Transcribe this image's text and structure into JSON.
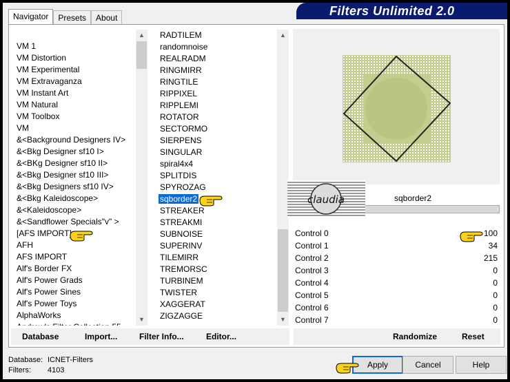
{
  "window": {
    "title": "Filters Unlimited 2.0"
  },
  "tabs": [
    {
      "label": "Navigator",
      "active": true
    },
    {
      "label": "Presets",
      "active": false
    },
    {
      "label": "About",
      "active": false
    }
  ],
  "categories": [
    "VM 1",
    "VM Distortion",
    "VM Experimental",
    "VM Extravaganza",
    "VM Instant Art",
    "VM Natural",
    "VM Toolbox",
    "VM",
    "&<Background Designers IV>",
    "&<Bkg Designer sf10 I>",
    "&<BKg Designer sf10 II>",
    "&<Bkg Designer sf10 III>",
    "&<Bkg Designers sf10 IV>",
    "&<Bkg Kaleidoscope>",
    "&<Kaleidoscope>",
    "&<Sandflower Specials\"v\" >",
    "[AFS IMPORT]",
    "AFH",
    "AFS IMPORT",
    "Alf's Border FX",
    "Alf's Power Grads",
    "Alf's Power Sines",
    "Alf's Power Toys",
    "AlphaWorks",
    "Andrew's Filter Collection 55"
  ],
  "filters": [
    "RADTILEM",
    "randomnoise",
    "REALRADM",
    "RINGMIRR",
    "RINGTILE",
    "RIPPIXEL",
    "RIPPLEMI",
    "ROTATOR",
    "SECTORMO",
    "SIERPENS",
    "SINGULAR",
    "spiral4x4",
    "SPLITDIS",
    "SPYROZAG",
    "sqborder2",
    "STREAKER",
    "STREAKMI",
    "SUBNOISE",
    "SUPERINV",
    "TILEMIRR",
    "TREMORSC",
    "TURBINEM",
    "TWISTER",
    "XAGGERAT",
    "ZIGZAGGE"
  ],
  "selected_filter": "sqborder2",
  "preview": {
    "filter_name": "sqborder2",
    "watermark": "claudia"
  },
  "controls": [
    {
      "label": "Control 0",
      "value": "100"
    },
    {
      "label": "Control 1",
      "value": "34"
    },
    {
      "label": "Control 2",
      "value": "215"
    },
    {
      "label": "Control 3",
      "value": "0"
    },
    {
      "label": "Control 4",
      "value": "0"
    },
    {
      "label": "Control 5",
      "value": "0"
    },
    {
      "label": "Control 6",
      "value": "0"
    },
    {
      "label": "Control 7",
      "value": "0"
    }
  ],
  "toolbar_left": {
    "database": "Database",
    "import": "Import...",
    "filter_info": "Filter Info...",
    "editor": "Editor..."
  },
  "toolbar_right": {
    "randomize": "Randomize",
    "reset": "Reset"
  },
  "status": {
    "database_label": "Database:",
    "database_value": "ICNET-Filters",
    "filters_label": "Filters:",
    "filters_value": "4103"
  },
  "buttons": {
    "apply": "Apply",
    "cancel": "Cancel",
    "help": "Help"
  },
  "colors": {
    "selection": "#0a6bd6",
    "title_bar": "#0a1a6e",
    "preview_fill": "#c4cc8e"
  }
}
